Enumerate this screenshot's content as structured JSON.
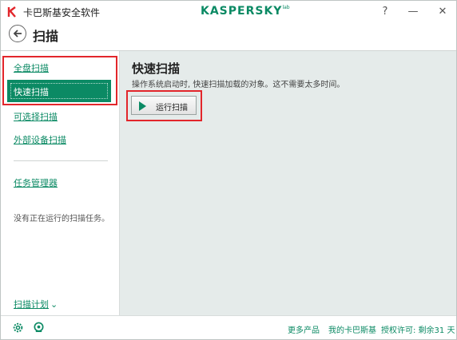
{
  "window": {
    "title": "卡巴斯基安全软件",
    "brand": "KASPERSKY",
    "brand_suffix": "lab",
    "help_label": "?",
    "minimize_label": "—",
    "close_label": "✕"
  },
  "header": {
    "title": "扫描"
  },
  "sidebar": {
    "items": [
      {
        "label": "全盘扫描",
        "selected": false
      },
      {
        "label": "快速扫描",
        "selected": true
      },
      {
        "label": "可选择扫描",
        "selected": false
      },
      {
        "label": "外部设备扫描",
        "selected": false
      }
    ],
    "task_manager": {
      "label": "任务管理器",
      "desc": "没有正在运行的扫描任务。"
    },
    "schedule": {
      "label": "扫描计划",
      "chevron": "⌄"
    }
  },
  "main": {
    "title": "快速扫描",
    "desc": "操作系统启动时, 快速扫描加载的对象。这不需要太多时间。",
    "run_button": "运行扫描"
  },
  "footer": {
    "more_products": "更多产品",
    "my_kaspersky": "我的卡巴斯基",
    "license": "授权许可: 剩余31 天"
  },
  "colors": {
    "accent": "#0b8a64",
    "highlight": "#e2262b",
    "panel": "#e5ebea"
  },
  "icons": [
    "kaspersky-k-icon",
    "back-arrow-icon",
    "play-icon",
    "settings-icon",
    "support-icon"
  ]
}
